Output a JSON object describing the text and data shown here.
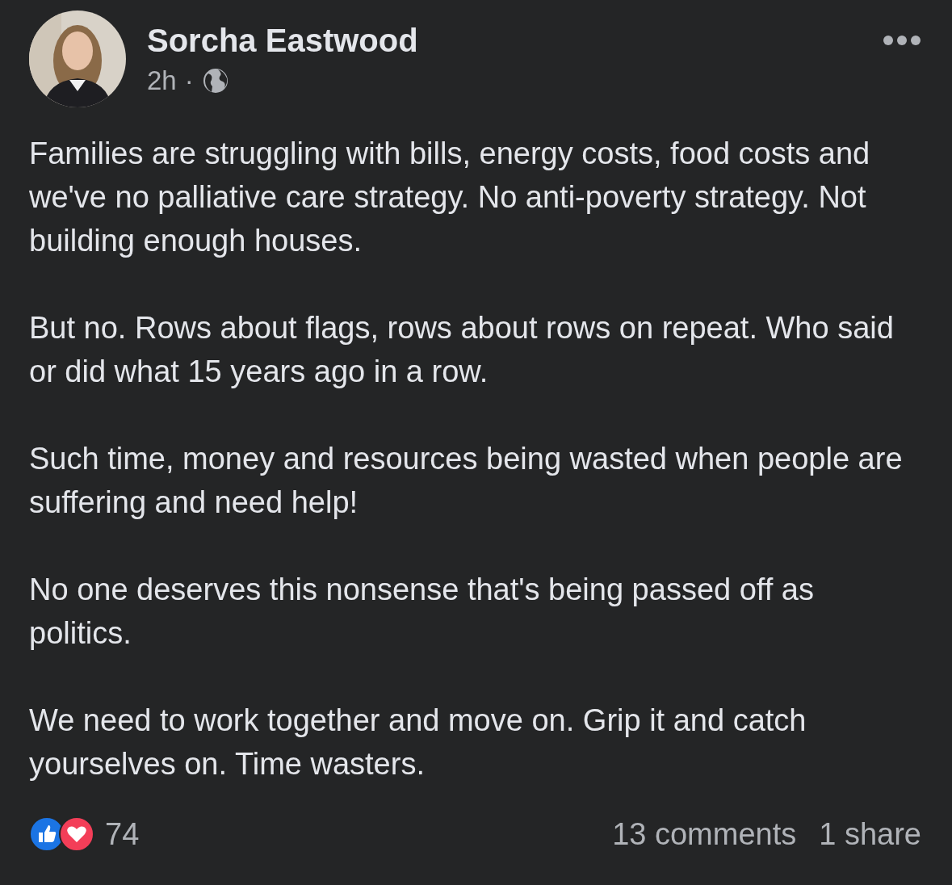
{
  "post": {
    "author": "Sorcha Eastwood",
    "time": "2h",
    "separator": "·",
    "paragraphs": [
      "Families are struggling with bills, energy costs, food costs and we've no palliative care strategy. No anti-poverty strategy. Not building enough houses.",
      "But no. Rows about flags, rows about rows on repeat. Who said or did what 15 years ago in a row.",
      "Such time, money and resources being wasted when people are suffering and need help!",
      "No one deserves this nonsense that's being passed off as politics.",
      "We need to work together and move on. Grip it and catch yourselves on. Time wasters."
    ],
    "reactions": {
      "count": "74"
    },
    "comments": "13 comments",
    "shares": "1 share"
  }
}
